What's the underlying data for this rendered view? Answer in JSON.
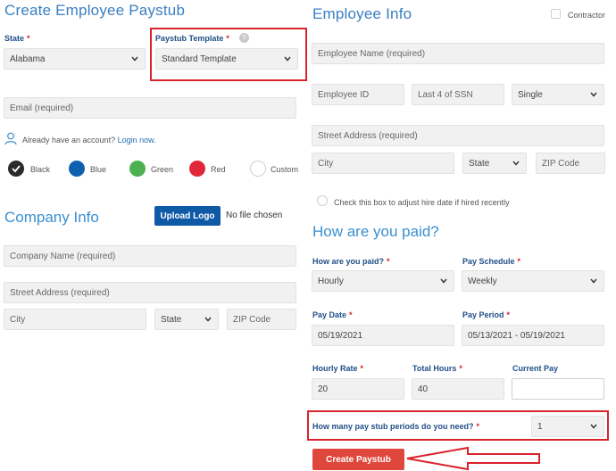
{
  "left": {
    "title": "Create Employee Paystub",
    "state_label": "State",
    "state_value": "Alabama",
    "template_label": "Paystub Template",
    "template_value": "Standard Template",
    "email_placeholder": "Email (required)",
    "account_text": "Already have an account?",
    "login_link": "Login now.",
    "colors": [
      {
        "label": "Black",
        "hex": "#2b2b2b"
      },
      {
        "label": "Blue",
        "hex": "#1060b0"
      },
      {
        "label": "Green",
        "hex": "#4cb050"
      },
      {
        "label": "Red",
        "hex": "#e0283a"
      },
      {
        "label": "Custom",
        "hex": "#ffffff"
      }
    ],
    "company_title": "Company Info",
    "upload_logo": "Upload Logo",
    "no_file": "No file chosen",
    "company_name_placeholder": "Company Name (required)",
    "street_placeholder": "Street Address (required)",
    "city_placeholder": "City",
    "state_select": "State",
    "zip_placeholder": "ZIP Code"
  },
  "right": {
    "title": "Employee Info",
    "contractor_label": "Contractor",
    "employee_name_placeholder": "Employee Name (required)",
    "employee_id_placeholder": "Employee ID",
    "ssn_placeholder": "Last 4 of SSN",
    "marital_value": "Single",
    "street_placeholder": "Street Address (required)",
    "city_placeholder": "City",
    "state_select": "State",
    "zip_placeholder": "ZIP Code",
    "hire_text": "Check this box to adjust hire date if hired recently",
    "paid_title": "How are you paid?",
    "paid_label": "How are you paid?",
    "paid_value": "Hourly",
    "schedule_label": "Pay Schedule",
    "schedule_value": "Weekly",
    "pay_date_label": "Pay Date",
    "pay_date_value": "05/19/2021",
    "pay_period_label": "Pay Period",
    "pay_period_value": "05/13/2021 - 05/19/2021",
    "hourly_rate_label": "Hourly Rate",
    "hourly_rate_value": "20",
    "total_hours_label": "Total Hours",
    "total_hours_value": "40",
    "current_pay_label": "Current Pay",
    "current_pay_value": "",
    "periods_label": "How many pay stub periods do you need?",
    "periods_value": "1",
    "create_button": "Create Paystub"
  },
  "accent_colors": {
    "heading": "#3a7fc1",
    "label": "#1f4f86",
    "required": "#d9232d",
    "highlight": "#d9232d",
    "button": "#e0473c"
  }
}
